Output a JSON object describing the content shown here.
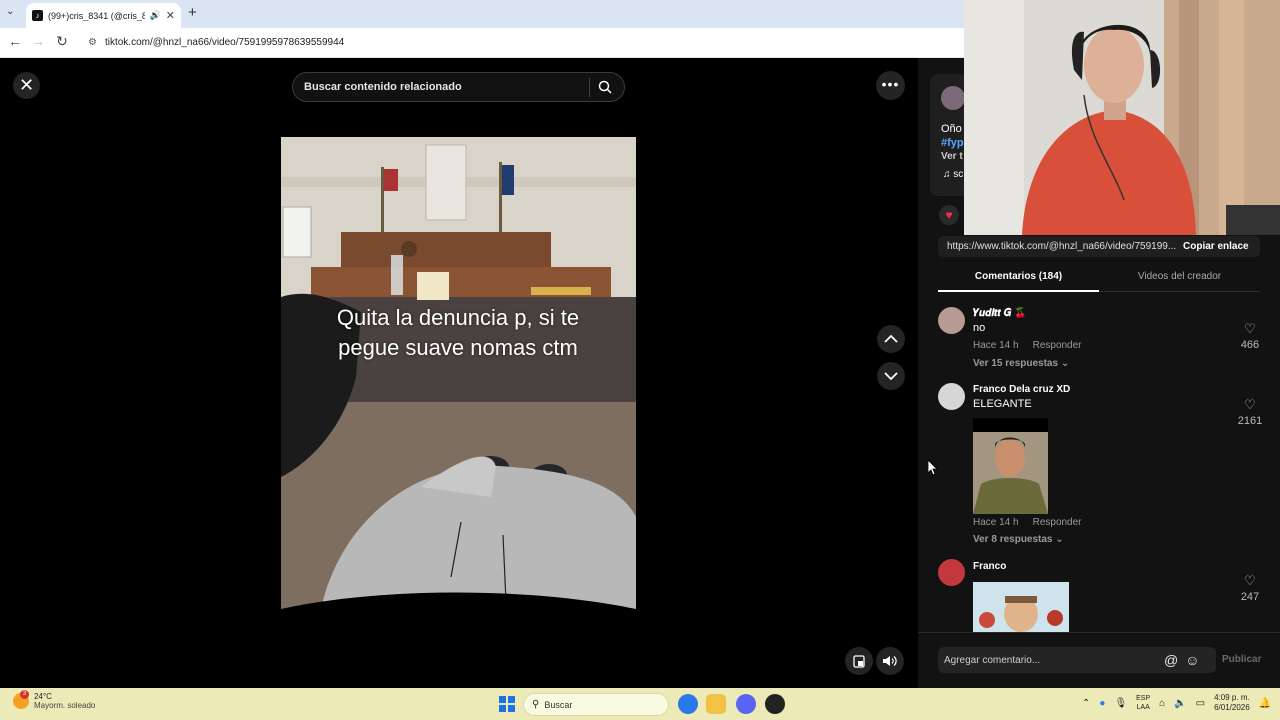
{
  "browser": {
    "tab_title": "(99+)cris_8341 (@cris_834",
    "url": "tiktok.com/@hnzl_na66/video/7591995978639559944"
  },
  "viewer": {
    "search_placeholder": "Buscar contenido relacionado",
    "caption": "Quita la denuncia p, si te pegue suave nomas ctm"
  },
  "panel": {
    "author_desc_1": "Oño",
    "author_desc_2": "#fyp",
    "author_desc_3": "Ver t",
    "music": "sc",
    "link": "https://www.tiktok.com/@hnzl_na66/video/759199...",
    "copy_link": "Copiar enlace",
    "tabs": [
      "Comentarios (184)",
      "Videos del creador"
    ],
    "comments": [
      {
        "name": "𝒀𝒖𝒅𝒊𝒕𝒕 𝑮 🍒",
        "text": "no",
        "time": "Hace 14 h",
        "reply": "Responder",
        "replies": "Ver 15 respuestas",
        "likes": "466"
      },
      {
        "name": "Franco Dela cruz XD",
        "text": "ELEGANTE",
        "time": "Hace 14 h",
        "reply": "Responder",
        "replies": "Ver 8 respuestas",
        "likes": "2161"
      },
      {
        "name": "Franco",
        "text": "",
        "likes": "247"
      }
    ],
    "comment_placeholder": "Agregar comentario...",
    "publish": "Publicar"
  },
  "taskbar": {
    "temp": "24°C",
    "weather": "Mayorm. soleado",
    "weather_badge": "3",
    "search": "Buscar",
    "lang_1": "ESP",
    "lang_2": "LAA",
    "time": "4:09 p. m.",
    "date": "6/01/2026"
  },
  "colors": {
    "accent": "#fe2c55",
    "panel_bg": "#121212",
    "taskbar_bg": "#ecebb7"
  }
}
